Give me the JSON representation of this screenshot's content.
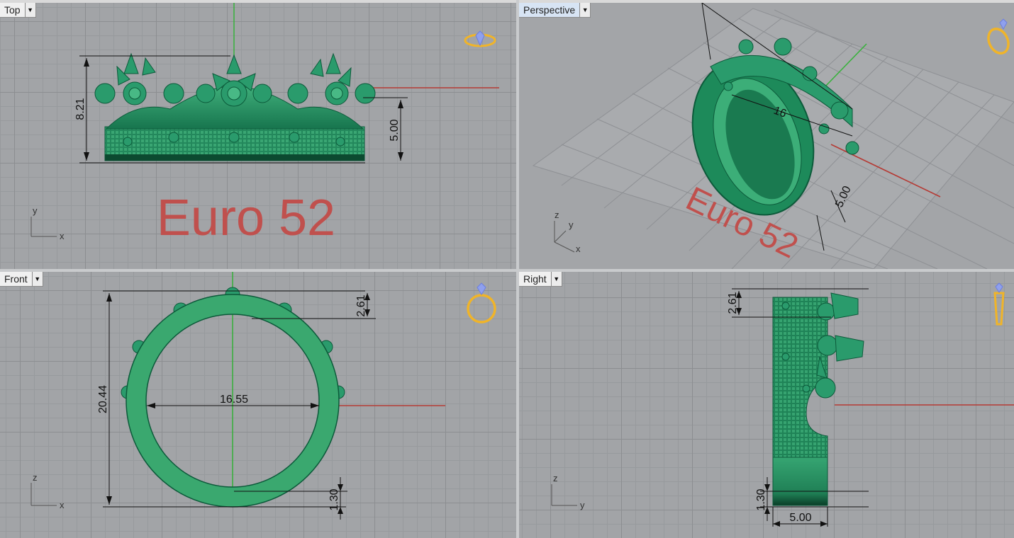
{
  "viewports": {
    "top": {
      "label": "Top",
      "dim_height": "8.21",
      "dim_band": "5.00",
      "watermark": "Euro 52",
      "axis_x": "x",
      "axis_y": "y"
    },
    "perspective": {
      "label": "Perspective",
      "watermark": "Euro 52",
      "dim_a": "5.00",
      "dim_b": "16",
      "axis_x": "x",
      "axis_y": "y",
      "axis_z": "z"
    },
    "front": {
      "label": "Front",
      "dim_height": "20.44",
      "dim_inner": "16.55",
      "dim_top": "2.61",
      "dim_bottom": "1.30",
      "axis_x": "x",
      "axis_z": "z"
    },
    "right": {
      "label": "Right",
      "dim_top": "2.61",
      "dim_bottom": "1.30",
      "dim_width": "5.00",
      "axis_y": "y",
      "axis_z": "z"
    }
  },
  "colors": {
    "ring_green": "#2a9b6c",
    "axis_red": "#b53b35",
    "axis_green": "#37b23b",
    "watermark": "#c0504d",
    "gizmo_gold": "#f0b429",
    "gizmo_blue": "#6c7fe0"
  },
  "icons": [
    "dropdown-arrow-icon",
    "ring-gizmo-icon",
    "axis-triad-icon"
  ]
}
